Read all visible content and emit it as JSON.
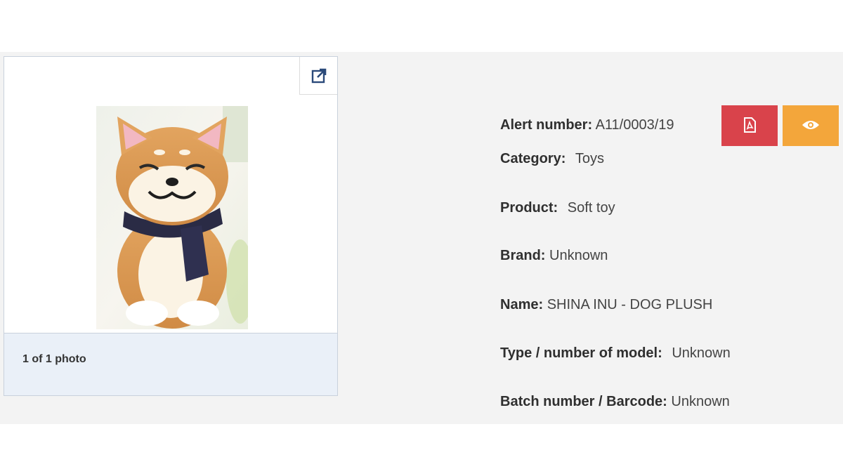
{
  "gallery": {
    "caption": "1 of 1 photo",
    "photo_icon": "plush-dog-photo",
    "popout_icon": "external-link-icon"
  },
  "alert": {
    "alert_number_label": "Alert number:",
    "alert_number_value": "A11/0003/19",
    "category_label": "Category:",
    "category_value": "Toys",
    "product_label": "Product:",
    "product_value": "Soft toy",
    "brand_label": "Brand:",
    "brand_value": "Unknown",
    "name_label": "Name:",
    "name_value": "SHINA INU - DOG PLUSH",
    "type_label": "Type / number of model:",
    "type_value": "Unknown",
    "batch_label": "Batch number / Barcode:",
    "batch_value": "Unknown"
  },
  "actions": {
    "pdf_icon": "pdf-icon",
    "view_icon": "eye-icon",
    "pdf_color": "#d9434b",
    "view_color": "#f3a63b"
  }
}
